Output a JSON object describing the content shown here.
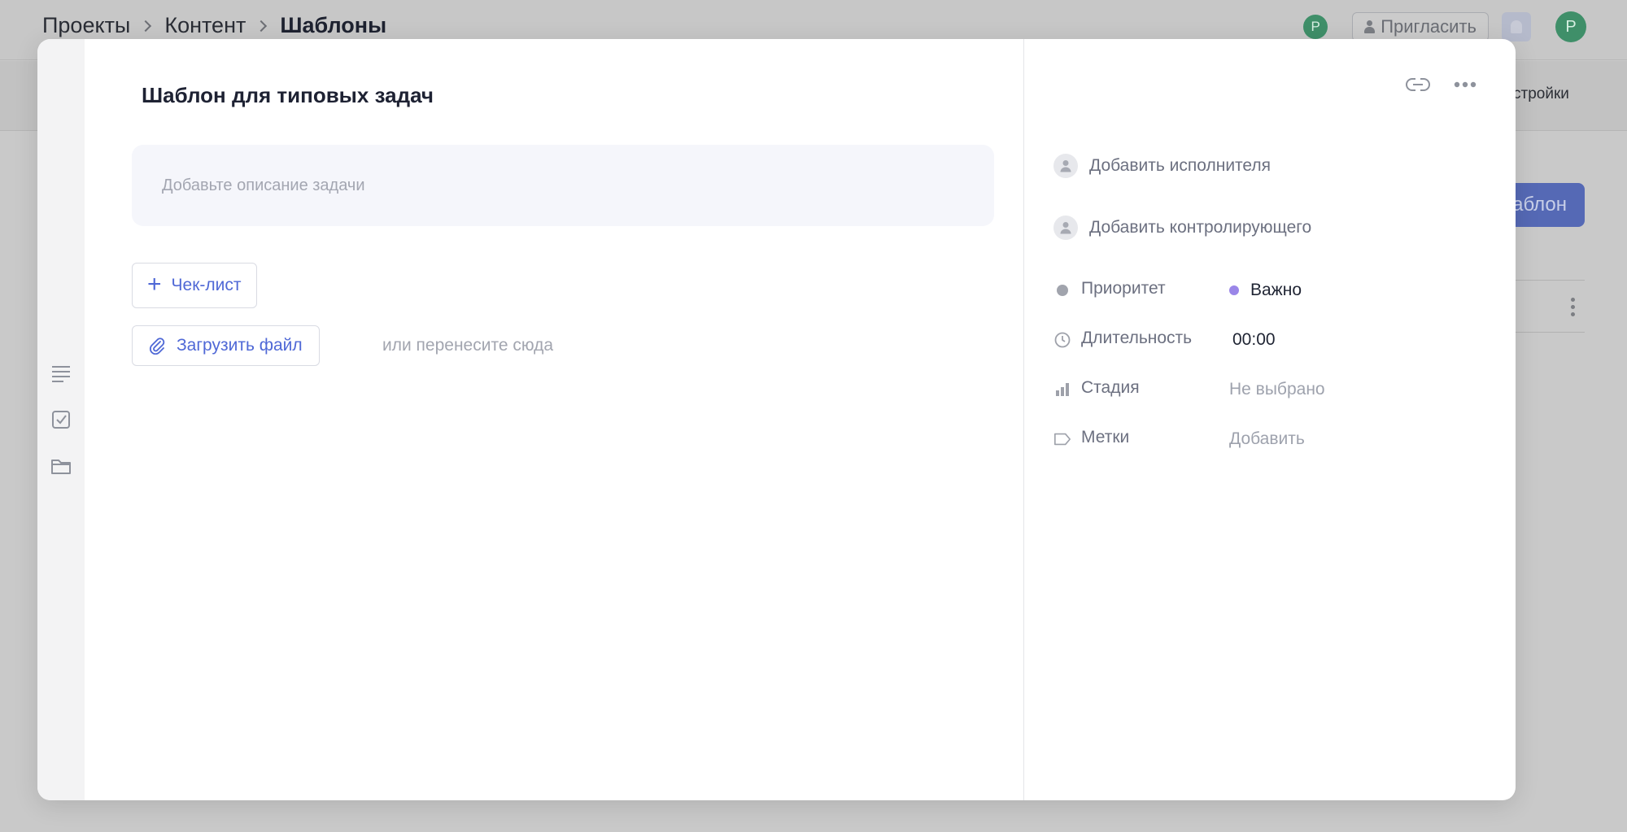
{
  "header": {
    "breadcrumb": [
      "Проекты",
      "Контент",
      "Шаблоны"
    ],
    "small_avatar_letter": "P",
    "invite_label": "Пригласить",
    "user_avatar_letter": "P",
    "settings_tab_label": "стройки",
    "create_button_label": "аблон"
  },
  "task": {
    "title": "Шаблон для типовых задач",
    "description_placeholder": "Добавьте описание задачи",
    "checklist_label": "Чек-лист",
    "upload_label": "Загрузить файл",
    "drop_hint": "или перенесите сюда"
  },
  "side": {
    "add_assignee": "Добавить исполнителя",
    "add_controller": "Добавить контролирующего",
    "properties": [
      {
        "label": "Приоритет",
        "value": "Важно",
        "icon": "priority-dot-icon"
      },
      {
        "label": "Длительность",
        "value": "00:00",
        "icon": "clock-icon"
      },
      {
        "label": "Стадия",
        "value": "Не выбрано",
        "icon": "stage-bars-icon"
      },
      {
        "label": "Метки",
        "value": "Добавить",
        "icon": "tag-icon"
      }
    ]
  },
  "colors": {
    "accent": "#4f68d6",
    "priority_important": "#9a86e8",
    "avatar_green": "#3f8f69"
  }
}
